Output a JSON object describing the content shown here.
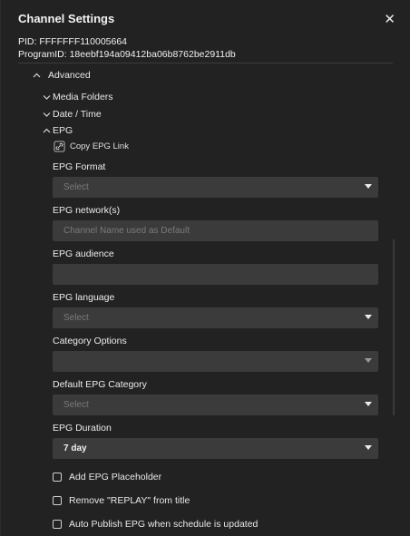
{
  "dialog": {
    "title": "Channel Settings",
    "close_glyph": "✕",
    "pid": "PID: FFFFFFF110005664",
    "program_id": "ProgramID: 18eebf194a09412ba06b8762be2911db"
  },
  "sections": {
    "advanced": "Advanced",
    "media_folders": "Media Folders",
    "date_time": "Date / Time",
    "epg": "EPG"
  },
  "epg": {
    "copy_link": "Copy EPG Link",
    "format_label": "EPG Format",
    "format_placeholder": "Select",
    "network_label": "EPG network(s)",
    "network_placeholder": "Channel Name used as Default",
    "audience_label": "EPG audience",
    "audience_value": "",
    "language_label": "EPG language",
    "language_placeholder": "Select",
    "category_options_label": "Category Options",
    "category_options_value": "",
    "default_category_label": "Default EPG Category",
    "default_category_placeholder": "Select",
    "duration_label": "EPG Duration",
    "duration_value": "7 day",
    "checkboxes": [
      {
        "label": "Add EPG Placeholder",
        "checked": false
      },
      {
        "label": "Remove \"REPLAY\" from title",
        "checked": false
      },
      {
        "label": "Auto Publish EPG when schedule is updated",
        "checked": false
      }
    ]
  },
  "icons": {
    "close": "close-icon",
    "chevron_up": "chevron-up-icon",
    "chevron_down": "chevron-down-icon",
    "link": "link-icon",
    "caret": "caret-down-icon"
  }
}
